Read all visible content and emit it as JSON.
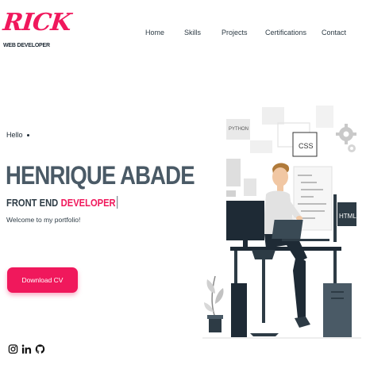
{
  "header": {
    "logo_text": "RICK",
    "logo_subtitle": "WEB DEVELOPER",
    "nav": [
      {
        "label": "Home"
      },
      {
        "label": "Skills"
      },
      {
        "label": "Projects"
      },
      {
        "label": "Certifications"
      },
      {
        "label": "Contact"
      }
    ]
  },
  "hero": {
    "greeting": "Hello",
    "name": "HENRIQUE ABADE",
    "role_prefix": "FRONT END",
    "role_highlight": "DEVELOPER",
    "welcome": "Welcome to my portfolio!",
    "cv_button": "Download CV"
  },
  "socials": [
    {
      "icon": "instagram-icon"
    },
    {
      "icon": "linkedin-icon"
    },
    {
      "icon": "github-icon"
    }
  ],
  "illustration": {
    "labels": {
      "python": "PYTHON",
      "css": "CSS",
      "html": "HTML"
    }
  },
  "colors": {
    "accent": "#f0185c",
    "text": "#2d3b45",
    "name": "#4a5a66"
  }
}
